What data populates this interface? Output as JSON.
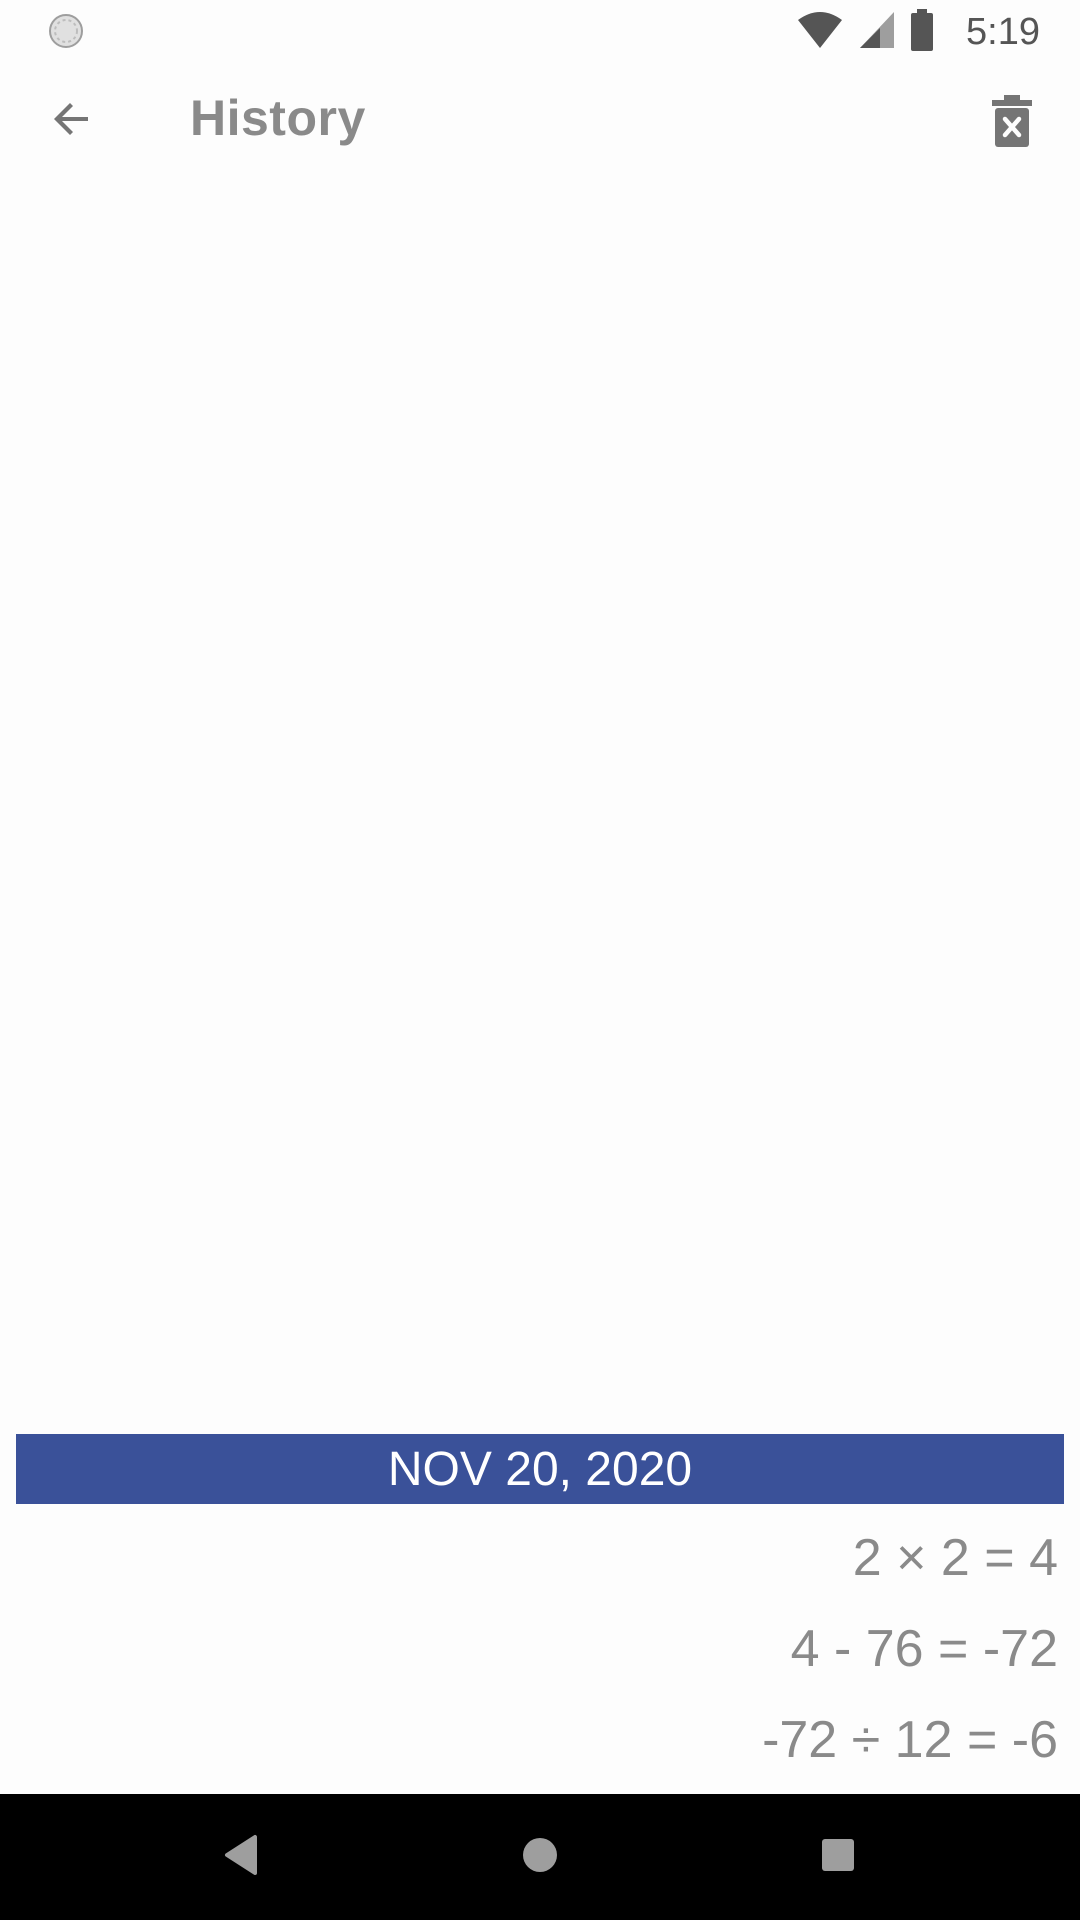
{
  "status_bar": {
    "time": "5:19",
    "icons": [
      "sync-icon",
      "wifi-icon",
      "signal-icon",
      "battery-icon"
    ]
  },
  "app_bar": {
    "title": "History",
    "back_icon": "arrow-back-icon",
    "delete_icon": "delete-history-icon"
  },
  "history": {
    "date": "NOV 20, 2020",
    "items": [
      "2 × 2 = 4",
      "4 - 76 = -72",
      "-72 ÷ 12 = -6"
    ]
  },
  "nav_bar": {
    "icons": [
      "back-triangle-icon",
      "home-circle-icon",
      "recents-square-icon"
    ]
  },
  "colors": {
    "accent": "#3a5199",
    "text_gray": "#8a8a8a",
    "background": "#fdfdfd"
  }
}
